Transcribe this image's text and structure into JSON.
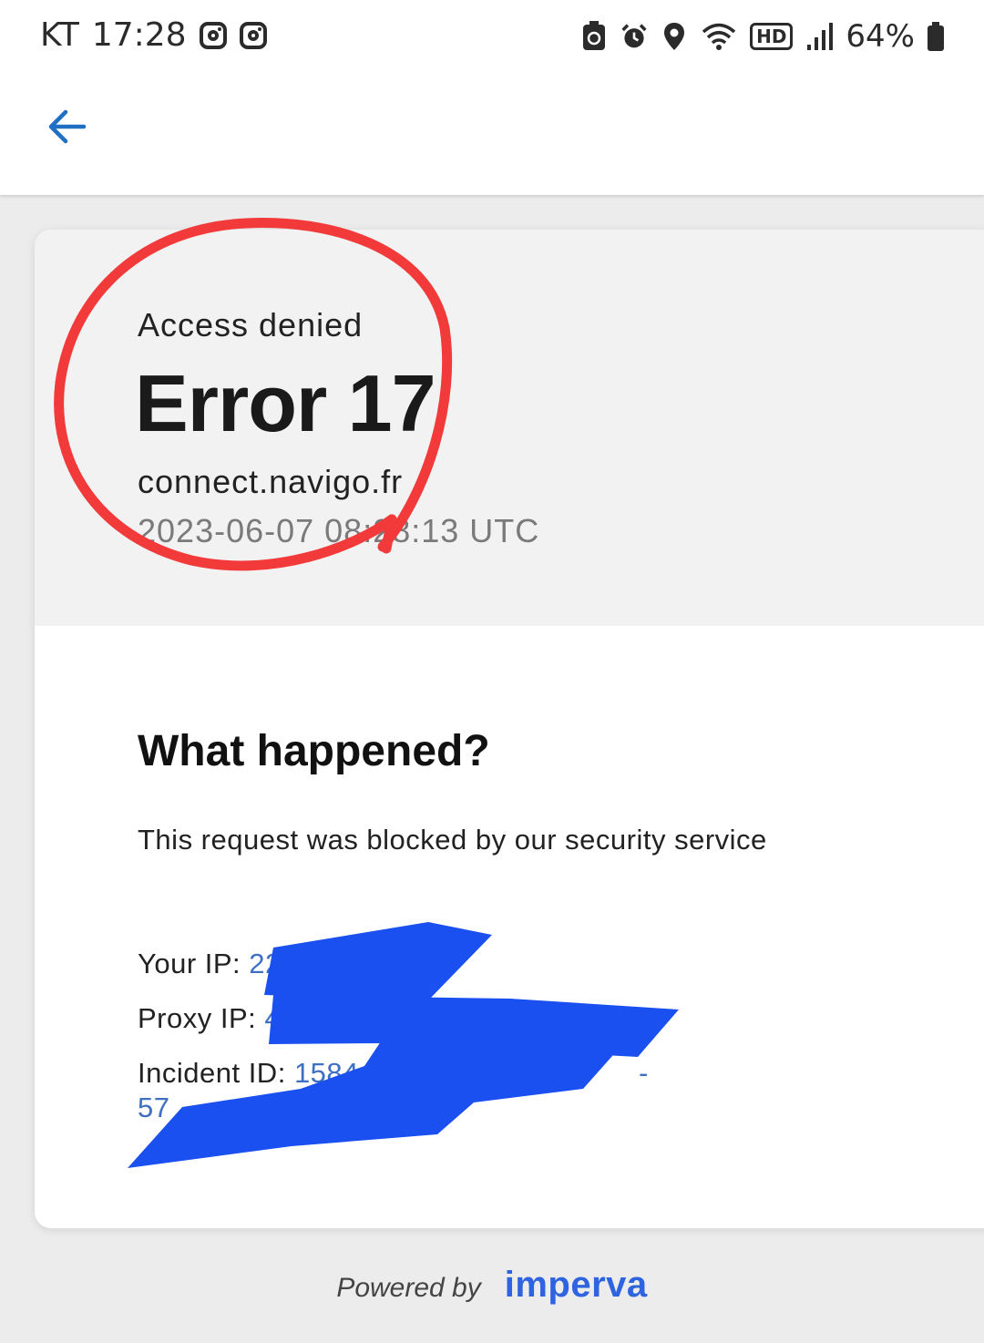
{
  "status_bar": {
    "carrier": "KT",
    "time": "17:28",
    "battery": "64%",
    "icons": [
      "instagram-icon",
      "instagram-icon",
      "battery-saver-icon",
      "alarm-icon",
      "location-icon",
      "wifi-icon",
      "hd-voice-icon",
      "signal-icon",
      "battery-icon"
    ],
    "hd_label": "HD"
  },
  "app_bar": {
    "back_icon": "arrow-left-icon",
    "accent": "#1f6fc4"
  },
  "error": {
    "heading": "Access denied",
    "code": "Error 17",
    "domain": "connect.navigo.fr",
    "timestamp": "2023-06-07 08:28:13 UTC"
  },
  "details": {
    "title": "What happened?",
    "description": "This request was blocked by our security service",
    "your_ip_label": "Your IP:",
    "your_ip_value": "22",
    "proxy_ip_label": "Proxy IP:",
    "proxy_ip_value": "4",
    "incident_id_label": "Incident ID:",
    "incident_id_value": "1584",
    "incident_id_value_tail": "-",
    "incident_id_line2": "57"
  },
  "footer": {
    "powered_by": "Powered by",
    "brand": "imperva",
    "brand_color": "#2f64e0"
  },
  "annotations": {
    "circle_color": "#f23a3a",
    "redaction_color": "#1a4ff0"
  }
}
